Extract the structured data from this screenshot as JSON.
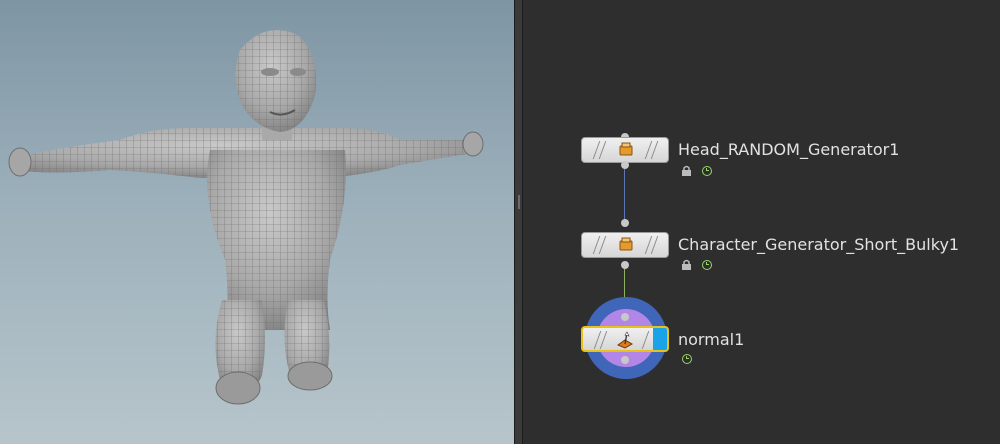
{
  "viewport": {
    "background_top": "#7e95a3",
    "background_bottom": "#b7c5cb",
    "mesh_color": "#8e8e8e"
  },
  "network": {
    "background": "#2e2e2e",
    "nodes": [
      {
        "name": "Head_RANDOM_Generator1",
        "icon": "hda-box-icon",
        "locked": true,
        "time_dependent": true
      },
      {
        "name": "Character_Generator_Short_Bulky1",
        "icon": "hda-box-icon",
        "locked": true,
        "time_dependent": true
      },
      {
        "name": "normal1",
        "icon": "normal-sop-icon",
        "selected": true,
        "display_flag": true,
        "locked": false,
        "time_dependent": true
      }
    ],
    "colors": {
      "selected_outline": "#e7c21a",
      "display_flag": "#1aa3e8",
      "ring_outer": "#3f66b8",
      "ring_inner": "#b286e6",
      "wire_blue": "#5b76b5",
      "wire_green": "#8bb060",
      "flag_green": "#9ad36a"
    }
  }
}
